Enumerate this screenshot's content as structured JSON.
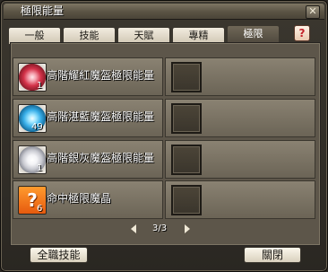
{
  "window": {
    "title": "極限能量",
    "close_symbol": "✕"
  },
  "tabs": [
    {
      "label": "一般",
      "active": false
    },
    {
      "label": "技能",
      "active": false
    },
    {
      "label": "天賦",
      "active": false
    },
    {
      "label": "專精",
      "active": false
    },
    {
      "label": "極限",
      "active": true
    }
  ],
  "help_symbol": "?",
  "items": [
    {
      "name": "高階耀紅魔盔極限能量",
      "count": "1",
      "icon": "red-orb-icon"
    },
    {
      "name": "高階湛藍魔盔極限能量",
      "count": "49",
      "icon": "blue-orb-icon"
    },
    {
      "name": "高階銀灰魔盔極限能量",
      "count": "1",
      "icon": "white-orb-icon"
    },
    {
      "name": "命中極限魔晶",
      "count": "6",
      "icon": "question-mark-icon"
    }
  ],
  "pager": {
    "text": "3/3"
  },
  "buttons": {
    "all_skills": "全職技能",
    "close": "關閉"
  }
}
